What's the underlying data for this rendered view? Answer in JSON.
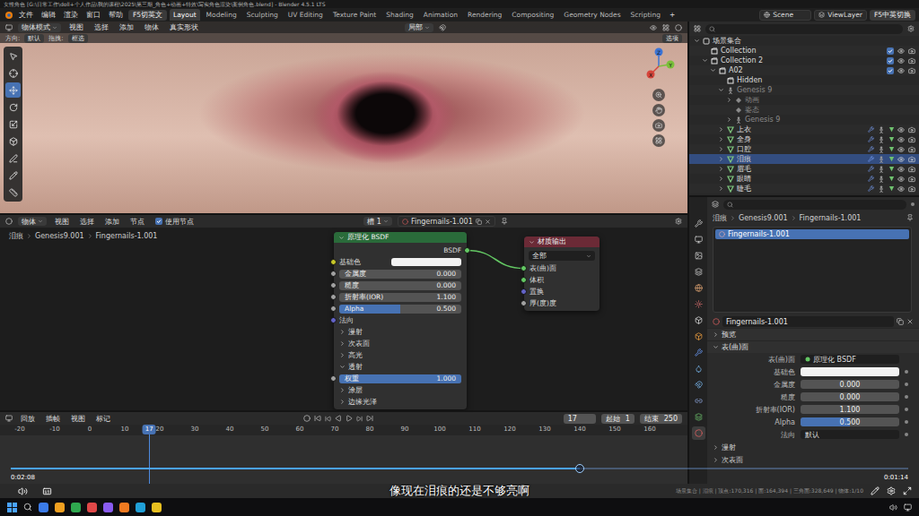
{
  "window": {
    "title": "女性角色 [G:\\日常工作\\doll+个人作品\\我的课程\\2025\\第三期_角色+动画+特效\\写实角色渲染\\案例角色.blend] - Blender 4.5.1 LTS"
  },
  "menu": [
    "文件",
    "编辑",
    "渲染",
    "窗口",
    "帮助"
  ],
  "language_button": "F5切英文",
  "workspaces": [
    {
      "label": "Layout",
      "selected": true
    },
    {
      "label": "Modeling",
      "selected": false
    },
    {
      "label": "Sculpting",
      "selected": false
    },
    {
      "label": "UV Editing",
      "selected": false
    },
    {
      "label": "Texture Paint",
      "selected": false
    },
    {
      "label": "Shading",
      "selected": false
    },
    {
      "label": "Animation",
      "selected": false
    },
    {
      "label": "Rendering",
      "selected": false
    },
    {
      "label": "Compositing",
      "selected": false
    },
    {
      "label": "Geometry Nodes",
      "selected": false
    },
    {
      "label": "Scripting",
      "selected": false
    }
  ],
  "add_workspace": "+",
  "scene": "Scene",
  "view_layer": "ViewLayer",
  "language_toggle": "F5中英切换",
  "viewport": {
    "mode": "物体模式",
    "menus": [
      "视图",
      "选择",
      "添加",
      "物体",
      "真实形状"
    ],
    "transform": "局部",
    "orientation_label": "方向:",
    "orientation": "默认",
    "drag_label": "拖拽:",
    "drag": "框选",
    "options": "选项",
    "tools": [
      {
        "selected": false
      },
      {
        "selected": false
      },
      {
        "selected": true
      },
      {
        "selected": false
      },
      {
        "selected": false
      },
      {
        "selected": false
      },
      {
        "selected": false
      },
      {
        "selected": false
      },
      {
        "selected": false
      }
    ],
    "gizmo": [
      {
        "label": "Z",
        "color": "#3b74d6"
      },
      {
        "label": "Y",
        "color": "#7bbf3a"
      },
      {
        "label": "X",
        "color": "#d6453b"
      }
    ]
  },
  "node_editor": {
    "type": "物体",
    "menus": [
      "视图",
      "选择",
      "添加",
      "节点"
    ],
    "use_nodes": {
      "label": "使用节点",
      "checked": true
    },
    "slot": "槽 1",
    "material": "Fingernails-1.001",
    "breadcrumb": [
      "泪痕",
      "Genesis9.001",
      "Fingernails-1.001"
    ],
    "bsdf": {
      "title": "原理化 BSDF",
      "output": "BSDF",
      "rows": [
        {
          "kind": "color",
          "label": "基础色",
          "color": "#c7c729",
          "value_color": "#f2f2f2"
        },
        {
          "kind": "slider",
          "label": "金属度",
          "value": "0.000",
          "level": 0,
          "color": "#a1a1a1"
        },
        {
          "kind": "slider",
          "label": "糙度",
          "value": "0.000",
          "level": 0,
          "color": "#a1a1a1"
        },
        {
          "kind": "slider",
          "label": "折射率(IOR)",
          "value": "1.100",
          "level": 0,
          "color": "#a1a1a1"
        },
        {
          "kind": "slider",
          "label": "Alpha",
          "value": "0.500",
          "level": 0.5,
          "color": "#a1a1a1"
        },
        {
          "kind": "socket",
          "label": "法向",
          "color": "#6363c7"
        },
        {
          "kind": "panel",
          "label": "漫射",
          "expanded": false
        },
        {
          "kind": "panel",
          "label": "次表面",
          "expanded": false
        },
        {
          "kind": "panel",
          "label": "高光",
          "expanded": false
        },
        {
          "kind": "panel",
          "label": "透射",
          "expanded": true
        },
        {
          "kind": "slider",
          "label": "权重",
          "value": "1.000",
          "level": 1,
          "color": "#a1a1a1"
        },
        {
          "kind": "panel",
          "label": "涂层",
          "expanded": false
        },
        {
          "kind": "panel",
          "label": "边缘光泽",
          "expanded": false
        }
      ]
    },
    "output": {
      "title": "材质输出",
      "target": "全部",
      "inputs": [
        {
          "label": "表(曲)面",
          "color": "#63c763"
        },
        {
          "label": "体积",
          "color": "#63c763"
        },
        {
          "label": "置换",
          "color": "#6363c7"
        },
        {
          "label": "厚(度)度",
          "color": "#a1a1a1"
        }
      ]
    }
  },
  "timeline": {
    "menus": [
      "回放",
      "插帧",
      "视图",
      "标记"
    ],
    "current_frame": "17",
    "start_label": "起始",
    "start": "1",
    "end_label": "结束",
    "end": "250",
    "playhead": "17",
    "ticks": [
      "-20",
      "-10",
      "0",
      "10",
      "20",
      "30",
      "40",
      "50",
      "60",
      "70",
      "80",
      "90",
      "100",
      "110",
      "120",
      "130",
      "140",
      "150",
      "160"
    ]
  },
  "outliner": {
    "rows": [
      {
        "label": "场景集合",
        "depth": 0,
        "kind": "scene",
        "expanded": true,
        "selected": false,
        "dim": false
      },
      {
        "label": "Collection",
        "depth": 1,
        "kind": "collection",
        "selected": false,
        "dim": false,
        "checked": true,
        "visible": true
      },
      {
        "label": "Collection 2",
        "depth": 1,
        "kind": "collection",
        "expanded": true,
        "selected": false,
        "dim": false,
        "checked": true,
        "visible": true
      },
      {
        "label": "A02",
        "depth": 2,
        "kind": "collection",
        "expanded": true,
        "selected": false,
        "dim": false,
        "checked": true,
        "visible": true
      },
      {
        "label": "Hidden",
        "depth": 3,
        "kind": "collection",
        "selected": false,
        "dim": false
      },
      {
        "label": "Genesis 9",
        "depth": 3,
        "kind": "armature",
        "expanded": true,
        "selected": false,
        "dim": true
      },
      {
        "label": "动画",
        "depth": 4,
        "kind": "action",
        "expanded": false,
        "selected": false,
        "dim": true
      },
      {
        "label": "姿态",
        "depth": 4,
        "kind": "action",
        "selected": false,
        "dim": true
      },
      {
        "label": "Genesis 9",
        "depth": 4,
        "kind": "armature",
        "expanded": false,
        "selected": false,
        "dim": true
      },
      {
        "label": "上衣",
        "depth": 3,
        "kind": "mesh",
        "expanded": false,
        "selected": false,
        "dim": false,
        "visible": true
      },
      {
        "label": "全身",
        "depth": 3,
        "kind": "mesh",
        "expanded": false,
        "selected": false,
        "dim": false,
        "visible": true
      },
      {
        "label": "口腔",
        "depth": 3,
        "kind": "mesh",
        "expanded": false,
        "selected": false,
        "dim": false,
        "visible": true
      },
      {
        "label": "泪痕",
        "depth": 3,
        "kind": "mesh",
        "expanded": false,
        "selected": true,
        "dim": false,
        "visible": true
      },
      {
        "label": "眉毛",
        "depth": 3,
        "kind": "mesh",
        "expanded": false,
        "selected": false,
        "dim": false,
        "visible": true
      },
      {
        "label": "眼睛",
        "depth": 3,
        "kind": "mesh",
        "expanded": false,
        "selected": false,
        "dim": false,
        "visible": true
      },
      {
        "label": "睫毛",
        "depth": 3,
        "kind": "mesh",
        "expanded": false,
        "selected": false,
        "dim": false,
        "visible": true
      }
    ]
  },
  "properties": {
    "tabs": [
      {
        "selected": false
      },
      {
        "selected": false
      },
      {
        "selected": false
      },
      {
        "selected": false
      },
      {
        "selected": false
      },
      {
        "selected": false
      },
      {
        "selected": false
      },
      {
        "selected": false
      },
      {
        "selected": false
      },
      {
        "selected": false
      },
      {
        "selected": false
      },
      {
        "selected": false
      },
      {
        "selected": false
      },
      {
        "selected": true
      }
    ],
    "breadcrumb": [
      "泪痕",
      "Genesis9.001",
      "Fingernails-1.001"
    ],
    "slots": [
      {
        "label": "Fingernails-1.001",
        "selected": true
      }
    ],
    "material": "Fingernails-1.001",
    "sections": [
      {
        "label": "预览",
        "expanded": false
      },
      {
        "label": "表(曲)面",
        "expanded": true
      }
    ],
    "surface_label": "表(曲)面",
    "surface": "原理化 BSDF",
    "fields": [
      {
        "kind": "color",
        "label": "基础色",
        "value_color": "#f2f2f2"
      },
      {
        "kind": "slider",
        "label": "金属度",
        "value": "0.000",
        "level": 0
      },
      {
        "kind": "slider",
        "label": "糙度",
        "value": "0.000",
        "level": 0
      },
      {
        "kind": "slider",
        "label": "折射率(IOR)",
        "value": "1.100",
        "level": 0
      },
      {
        "kind": "slider",
        "label": "Alpha",
        "value": "0.500",
        "level": 0.5
      },
      {
        "kind": "dropdown",
        "label": "法向",
        "value": "默认"
      }
    ],
    "subsections": [
      {
        "label": "漫射",
        "expanded": false
      },
      {
        "label": "次表面",
        "expanded": false
      }
    ]
  },
  "player": {
    "elapsed": "0:02:08",
    "remaining": "0:01:14",
    "level": 0.634,
    "subtitle": "像现在泪痕的还是不够亮啊"
  },
  "status_bar": "场景集合 | 泪痕 | 顶点:170,316 | 面:164,394 | 三角面:328,649 | 物体:1/10"
}
